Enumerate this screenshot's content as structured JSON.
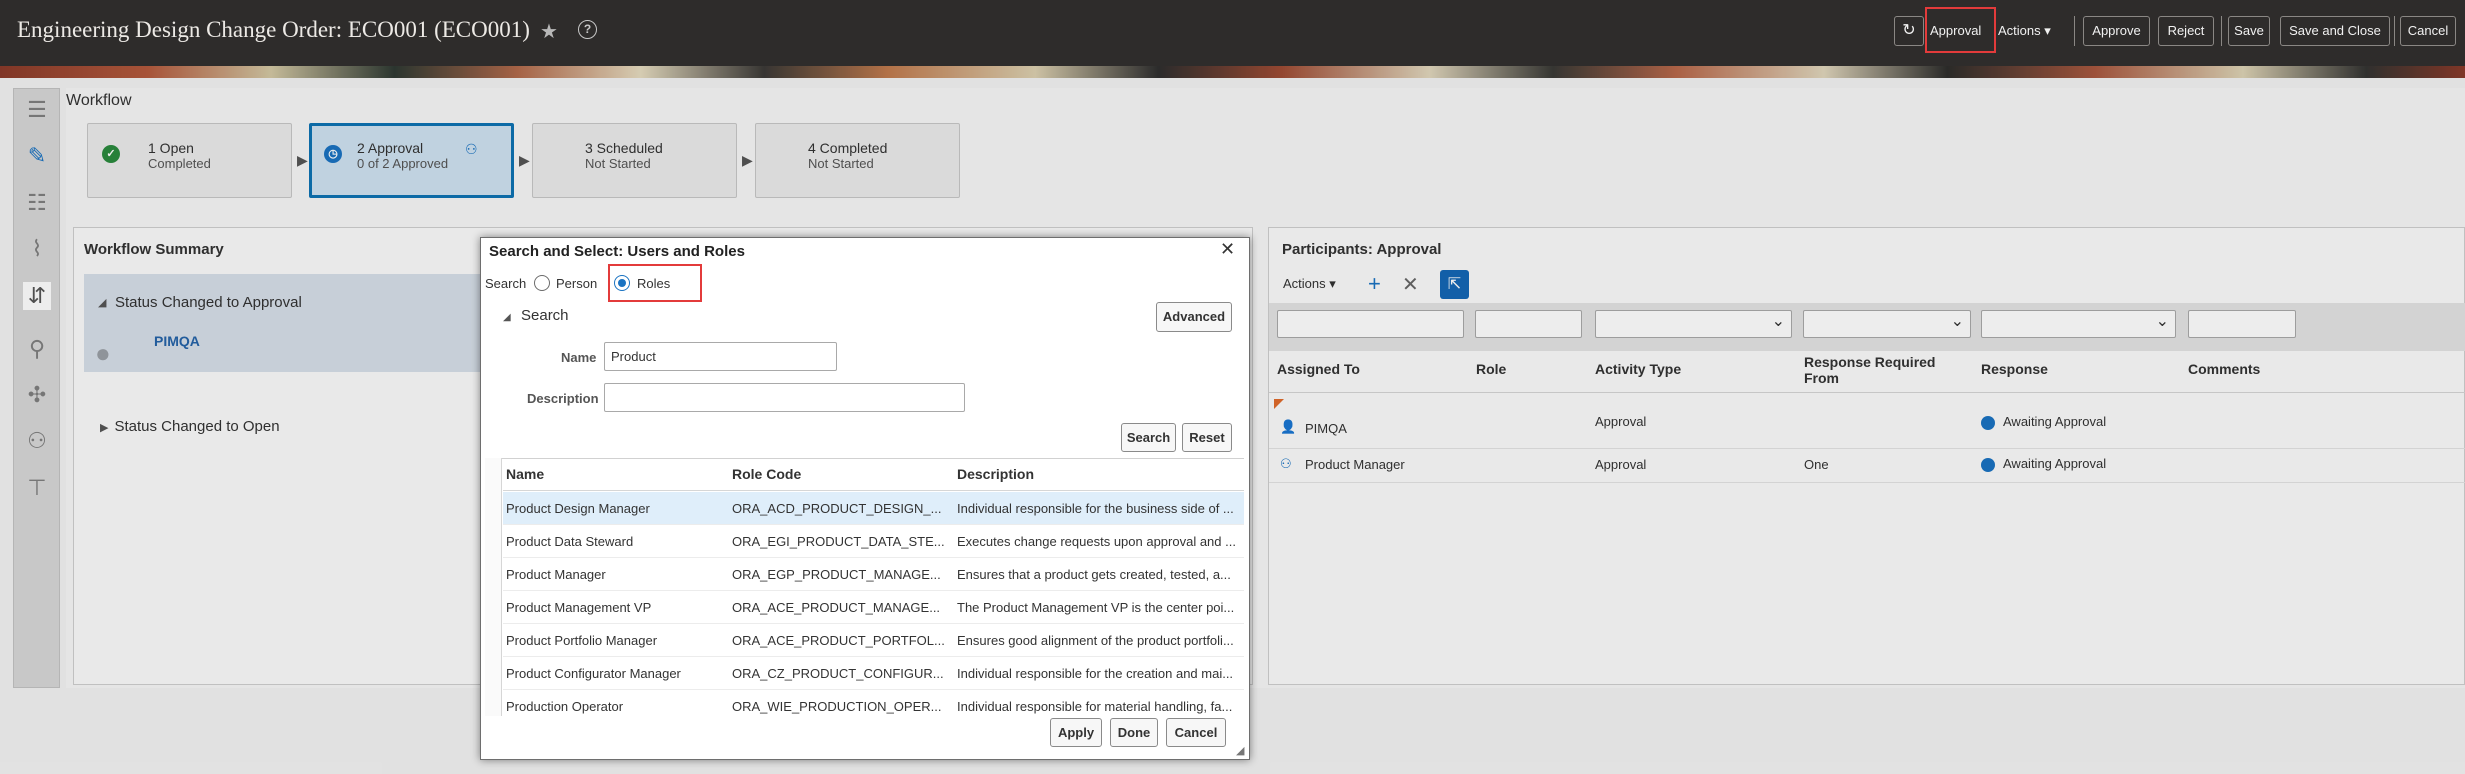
{
  "header": {
    "title": "Engineering Design Change Order: ECO001 (ECO001)",
    "approval_link": "Approval",
    "actions_link": "Actions",
    "approve_button": "Approve",
    "reject_button": "Reject",
    "save_button": "Save",
    "save_close_button": "Save and Close",
    "cancel_button": "Cancel",
    "help_glyph": "?"
  },
  "workflow": {
    "title": "Workflow",
    "steps": [
      {
        "name": "1 Open",
        "status": "Completed"
      },
      {
        "name": "2 Approval",
        "status": "0 of 2 Approved"
      },
      {
        "name": "3 Scheduled",
        "status": "Not Started"
      },
      {
        "name": "4 Completed",
        "status": "Not Started"
      }
    ]
  },
  "summary": {
    "title": "Workflow Summary",
    "row1_label": "Status Changed to Approval",
    "row1_user": "PIMQA",
    "row2_label": "Status Changed to Open"
  },
  "participants": {
    "title": "Participants: Approval",
    "actions_label": "Actions",
    "columns": [
      "Assigned To",
      "Role",
      "Activity Type",
      "Response Required From",
      "Response",
      "Comments"
    ],
    "rows": [
      {
        "assigned_to": "PIMQA",
        "role": "",
        "activity_type": "Approval",
        "response_required_from": "",
        "response": "Awaiting Approval",
        "comments": ""
      },
      {
        "assigned_to": "Product Manager",
        "role": "",
        "activity_type": "Approval",
        "response_required_from": "One",
        "response": "Awaiting Approval",
        "comments": ""
      }
    ]
  },
  "dialog": {
    "title": "Search and Select: Users and Roles",
    "search_label": "Search",
    "option_person": "Person",
    "option_roles": "Roles",
    "selected_option": "Roles",
    "search_section": "Search",
    "advanced_button": "Advanced",
    "name_label": "Name",
    "name_value": "Product",
    "description_label": "Description",
    "description_value": "",
    "search_button": "Search",
    "reset_button": "Reset",
    "columns": [
      "Name",
      "Role Code",
      "Description"
    ],
    "results": [
      {
        "name": "Product Design Manager",
        "code": "ORA_ACD_PRODUCT_DESIGN_...",
        "desc": "Individual responsible for the business side of ..."
      },
      {
        "name": "Product Data Steward",
        "code": "ORA_EGI_PRODUCT_DATA_STE...",
        "desc": "Executes change requests upon approval and ..."
      },
      {
        "name": "Product Manager",
        "code": "ORA_EGP_PRODUCT_MANAGE...",
        "desc": "Ensures that a product gets created, tested, a..."
      },
      {
        "name": "Product Management VP",
        "code": "ORA_ACE_PRODUCT_MANAGE...",
        "desc": "The Product Management VP is the center poi..."
      },
      {
        "name": "Product Portfolio Manager",
        "code": "ORA_ACE_PRODUCT_PORTFOL...",
        "desc": "Ensures good alignment of the product portfoli..."
      },
      {
        "name": "Product Configurator Manager",
        "code": "ORA_CZ_PRODUCT_CONFIGUR...",
        "desc": "Individual responsible for the creation and mai..."
      },
      {
        "name": "Production Operator",
        "code": "ORA_WIE_PRODUCTION_OPER...",
        "desc": "Individual responsible for material handling, fa..."
      }
    ],
    "apply_button": "Apply",
    "done_button": "Done",
    "cancel_button": "Cancel"
  },
  "colors": {
    "accent": "#0d73b3",
    "highlight": "#e33b3b",
    "header_bg": "#2e2c2b"
  }
}
